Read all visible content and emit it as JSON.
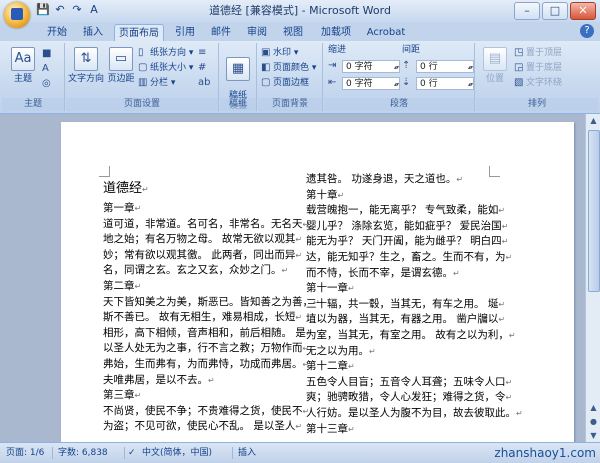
{
  "window": {
    "title": "道德经 [兼容模式] - Microsoft Word",
    "min": "–",
    "max": "□",
    "close": "✕",
    "qat": [
      "💾",
      "↶",
      "↷",
      "A"
    ]
  },
  "tabs": [
    "开始",
    "插入",
    "页面布局",
    "引用",
    "邮件",
    "审阅",
    "视图",
    "加载项",
    "Acrobat"
  ],
  "active_tab": "页面布局",
  "help": "?",
  "ribbon": {
    "theme_group": {
      "label": "主题",
      "btn_themes": "主题"
    },
    "page_setup": {
      "label": "页面设置",
      "text_direction": "文字方向",
      "margins": "页边距",
      "orientation": "纸张方向",
      "size": "纸张大小",
      "columns": "分栏"
    },
    "manuscript": {
      "label": "稿纸",
      "btn": "稿纸\n设置"
    },
    "background": {
      "label": "页面背景",
      "watermark": "水印",
      "page_color": "页面颜色",
      "page_border": "页面边框"
    },
    "paragraph": {
      "label": "段落",
      "indent_label": "缩进",
      "spacing_label": "间距",
      "indent_left": "0 字符",
      "indent_right": "0 字符",
      "spacing_before": "0 行",
      "spacing_after": "0 行"
    },
    "arrange": {
      "label": "排列",
      "position": "位置",
      "bring_front": "置于顶层",
      "send_back": "置于底层",
      "text_wrap": "文字环绕"
    }
  },
  "document": {
    "left_column": [
      "道德经",
      "第一章",
      "道可道，非常道。名可名，非常名。无名天",
      "地之始；有名万物之母。 故常无欲以观其",
      "妙；常有欲以观其徼。 此两者，同出而异",
      "名，同谓之玄。玄之又玄，众妙之门。",
      "第二章",
      "天下皆知美之为美，斯恶已。皆知善之为善，",
      "斯不善已。 故有无相生，难易相成，长短",
      "相形，高下相倾，音声相和，前后相随。 是",
      "以圣人处无为之事，行不言之教；万物作而",
      "弗始，生而弗有，为而弗恃，功成而弗居。",
      "夫唯弗居，是以不去。",
      "第三章",
      "不尚贤，使民不争；不贵难得之货，使民不",
      "为盗；不见可欲，使民心不乱。 是以圣人"
    ],
    "right_column": [
      "遗其咎。 功遂身退，天之道也。",
      "第十章",
      "载营魄抱一，能无离乎？ 专气致柔，能如",
      "婴儿乎？ 涤除玄览，能如疵乎？ 爱民治国",
      "能无为乎？ 天门开阖，能为雌乎？ 明白四",
      "达，能无知乎？生之，畜之。生而不有，为",
      "而不恃，长而不宰，是谓玄德。",
      "第十一章",
      "三十辐，共一毂，当其无，有车之用。 埏",
      "埴以为器，当其无，有器之用。 凿户牖以",
      "为室，当其无，有室之用。 故有之以为利，",
      "无之以为用。",
      "第十二章",
      "五色令人目盲；五音令人耳聋；五味令人口",
      "爽；驰骋畋猎，令人心发狂；难得之货，令",
      "人行妨。是以圣人为腹不为目，故去彼取此。",
      "第十三章"
    ]
  },
  "status": {
    "page": "页面: 1/6",
    "words": "字数: 6,838",
    "lang": "中文(简体，中国)",
    "mode": "插入",
    "watermark": "zhanshaoy1.com"
  },
  "colors": {
    "accent": "#15428b",
    "ribbon": "#dfeaf7",
    "doc_bg": "#a9b8cf"
  }
}
